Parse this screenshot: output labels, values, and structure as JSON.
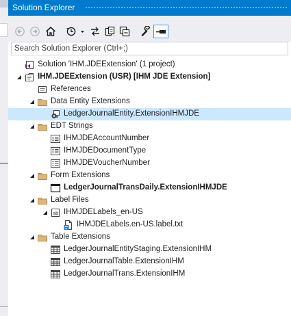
{
  "window": {
    "title": "Solution Explorer"
  },
  "toolbar": {
    "buttons": [
      {
        "name": "back",
        "icon": "back-arrow-icon"
      },
      {
        "name": "forward",
        "icon": "forward-arrow-icon"
      },
      {
        "name": "home",
        "icon": "home-icon"
      },
      {
        "name": "pending-changes-filter",
        "icon": "clock-icon"
      },
      {
        "name": "sync-with-active-document",
        "icon": "sync-icon"
      },
      {
        "name": "show-all-files",
        "icon": "copy-files-icon"
      },
      {
        "name": "collapse-all",
        "icon": "collapse-icon"
      },
      {
        "name": "properties",
        "icon": "wrench-icon"
      },
      {
        "name": "preview-selected-items",
        "icon": "minus-pin-icon",
        "state": "pressed"
      }
    ]
  },
  "search": {
    "placeholder": "Search Solution Explorer (Ctrl+;)",
    "value": ""
  },
  "tree": [
    {
      "label": "Solution 'IHM.JDEExtension' (1 project)",
      "icon": "solution-icon",
      "level": 0,
      "expander": "none",
      "bold": false,
      "selected": false
    },
    {
      "label": "IHM.JDEExtension (USR) [IHM JDE Extension]",
      "icon": "project-icon",
      "level": 0,
      "expander": "expanded",
      "bold": true,
      "selected": false
    },
    {
      "label": "References",
      "icon": "references-icon",
      "level": 1,
      "expander": "none",
      "bold": false,
      "selected": false
    },
    {
      "label": "Data Entity Extensions",
      "icon": "folder-icon",
      "level": 1,
      "expander": "expanded",
      "bold": false,
      "selected": false
    },
    {
      "label": "LedgerJournalEntity.ExtensionIHMJDE",
      "icon": "data-entity-extension-icon",
      "level": 2,
      "expander": "none",
      "bold": false,
      "selected": true
    },
    {
      "label": "EDT Strings",
      "icon": "folder-icon",
      "level": 1,
      "expander": "expanded",
      "bold": false,
      "selected": false
    },
    {
      "label": "IHMJDEAccountNumber",
      "icon": "edt-icon",
      "level": 2,
      "expander": "none",
      "bold": false,
      "selected": false
    },
    {
      "label": "IHMJDEDocumentType",
      "icon": "edt-icon",
      "level": 2,
      "expander": "none",
      "bold": false,
      "selected": false
    },
    {
      "label": "IHMJDEVoucherNumber",
      "icon": "edt-icon",
      "level": 2,
      "expander": "none",
      "bold": false,
      "selected": false
    },
    {
      "label": "Form Extensions",
      "icon": "folder-icon",
      "level": 1,
      "expander": "expanded",
      "bold": false,
      "selected": false
    },
    {
      "label": "LedgerJournalTransDaily.ExtensionIHMJDE",
      "icon": "form-icon",
      "level": 2,
      "expander": "none",
      "bold": true,
      "selected": false
    },
    {
      "label": "Label Files",
      "icon": "folder-icon",
      "level": 1,
      "expander": "expanded",
      "bold": false,
      "selected": false
    },
    {
      "label": "IHMJDELabels_en-US",
      "icon": "label-file-icon",
      "level": 2,
      "expander": "expanded",
      "bold": false,
      "selected": false
    },
    {
      "label": "IHMJDELabels.en-US.label.txt",
      "icon": "label-txt-icon",
      "level": 3,
      "expander": "none",
      "bold": false,
      "selected": false
    },
    {
      "label": "Table Extensions",
      "icon": "folder-icon",
      "level": 1,
      "expander": "expanded",
      "bold": false,
      "selected": false
    },
    {
      "label": "LedgerJournalEntityStaging.ExtensionIHM",
      "icon": "table-icon",
      "level": 2,
      "expander": "none",
      "bold": false,
      "selected": false
    },
    {
      "label": "LedgerJournalTable.ExtensionIHM",
      "icon": "table-icon",
      "level": 2,
      "expander": "none",
      "bold": false,
      "selected": false
    },
    {
      "label": "LedgerJournalTrans.ExtensionIHM",
      "icon": "table-icon",
      "level": 2,
      "expander": "none",
      "bold": false,
      "selected": false
    }
  ]
}
